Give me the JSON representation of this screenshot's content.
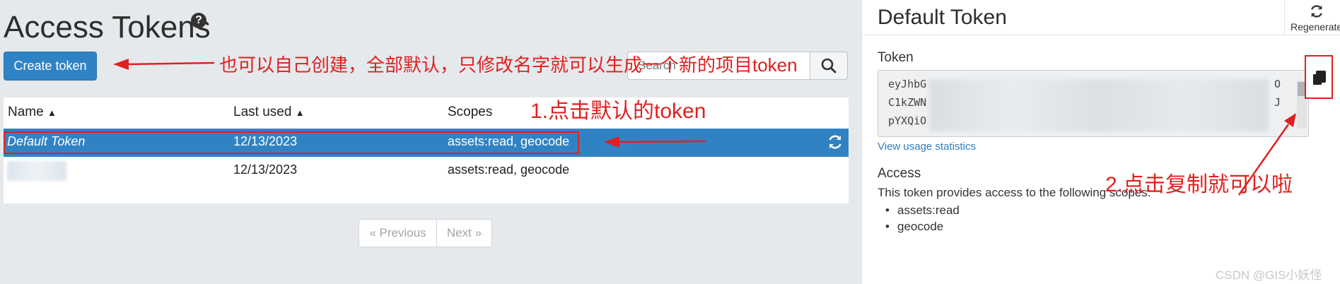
{
  "page": {
    "title": "Access Tokens",
    "help_icon": "?",
    "create_button": "Create token",
    "search": {
      "placeholder": "Search"
    }
  },
  "table": {
    "columns": [
      "Name",
      "Last used",
      "Scopes"
    ],
    "rows": [
      {
        "name": "Default Token",
        "last_used": "12/13/2023",
        "scopes": "assets:read, geocode",
        "selected": true
      },
      {
        "name": "",
        "last_used": "12/13/2023",
        "scopes": "assets:read, geocode",
        "selected": false
      }
    ]
  },
  "pagination": {
    "previous": "« Previous",
    "next": "Next »"
  },
  "detail": {
    "title": "Default Token",
    "regenerate": "Regenerate",
    "token_label": "Token",
    "token_lines": [
      {
        "start": "eyJhbG",
        "end": "O"
      },
      {
        "start": "C1kZWN",
        "end": "J"
      },
      {
        "start": "pYXQiO",
        "end": ""
      }
    ],
    "usage_link": "View usage statistics",
    "access_label": "Access",
    "access_desc": "This token provides access to the following scopes:",
    "scopes": [
      "assets:read",
      "geocode"
    ]
  },
  "annotations": {
    "create_hint": "也可以自己创建，全部默认，只修改名字就可以生成一个新的项目token",
    "step1": "1.点击默认的token",
    "step2": "2.点击复制就可以啦"
  },
  "watermark": "CSDN @GIS小妖怪",
  "colors": {
    "accent": "#2f83c4",
    "annotation": "#e02020",
    "link": "#2f7cbd"
  },
  "icons": {
    "help": "question-circle-icon",
    "search": "search-icon",
    "sort": "sort-icon",
    "refresh": "refresh-icon",
    "regenerate": "refresh-icon",
    "copy": "copy-icon"
  }
}
